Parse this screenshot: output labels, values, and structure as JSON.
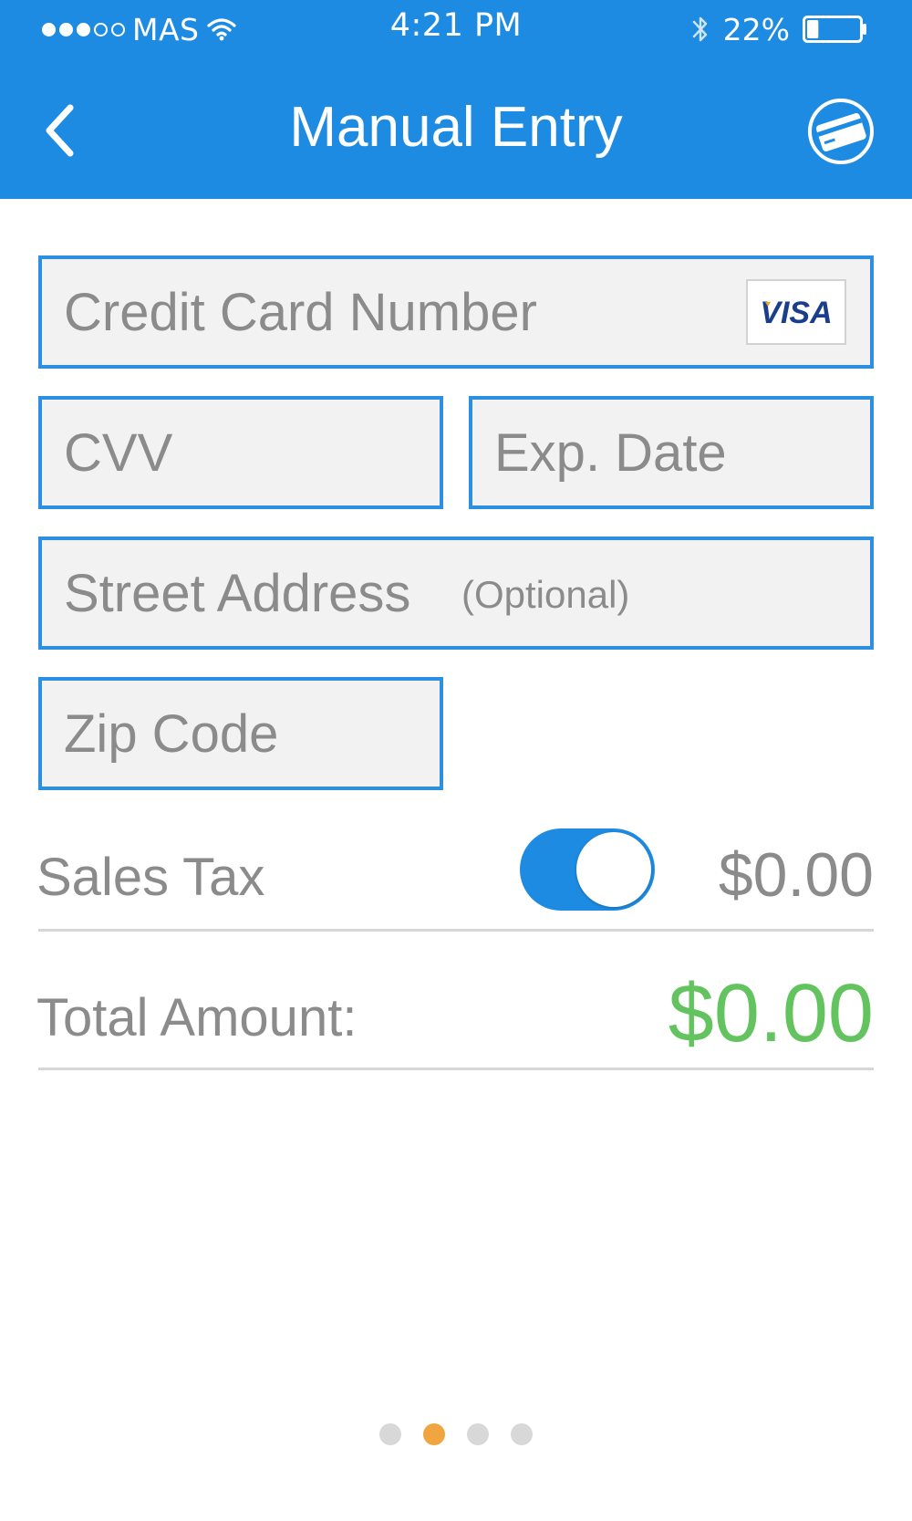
{
  "status_bar": {
    "carrier": "MAS",
    "signal_bars_filled": 3,
    "signal_bars_total": 5,
    "time": "4:21 PM",
    "battery_percent": "22%",
    "battery_level": 0.22
  },
  "header": {
    "title": "Manual Entry",
    "back_icon": "chevron-left-icon",
    "card_icon": "credit-card-icon",
    "background_color": "#1e8be3"
  },
  "form": {
    "card_number": {
      "placeholder": "Credit Card Number",
      "value": "",
      "brand": "VISA"
    },
    "cvv": {
      "placeholder": "CVV",
      "value": ""
    },
    "exp_date": {
      "placeholder": "Exp. Date",
      "value": ""
    },
    "street_address": {
      "placeholder": "Street Address",
      "optional_label": "(Optional)",
      "value": ""
    },
    "zip_code": {
      "placeholder": "Zip Code",
      "value": ""
    }
  },
  "sales_tax": {
    "label": "Sales Tax",
    "enabled": true,
    "amount": "$0.00"
  },
  "total": {
    "label": "Total Amount:",
    "amount": "$0.00",
    "amount_color": "#63c45f"
  },
  "pagination": {
    "page_count": 4,
    "active_index": 1,
    "active_color": "#f0a540"
  }
}
